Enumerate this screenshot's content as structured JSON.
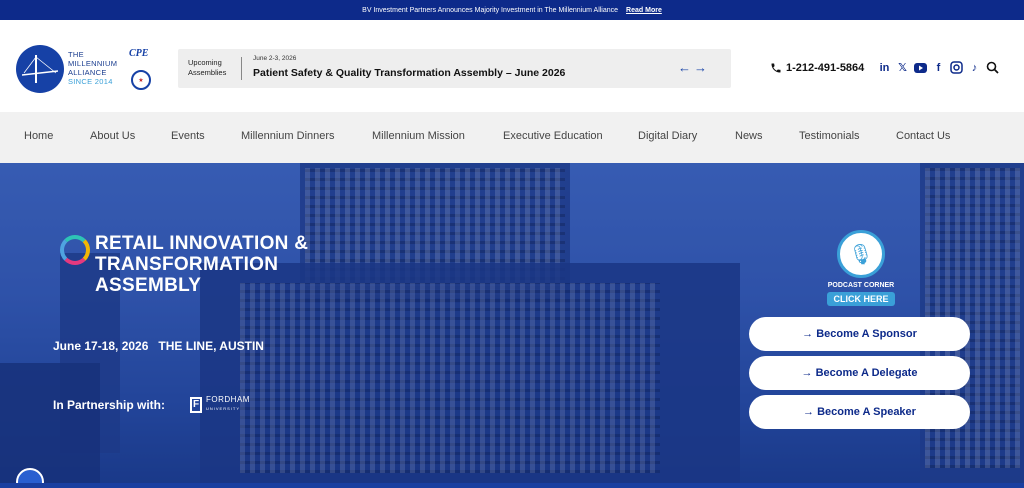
{
  "announcement": {
    "text": "BV Investment Partners Announces Majority Investment in The Millennium Alliance",
    "link": "Read More"
  },
  "brand": {
    "line1": "THE",
    "line2": "MILLENNIUM",
    "line3": "ALLIANCE",
    "since": "SINCE 2014",
    "cpe": "CPE"
  },
  "upcoming": {
    "label_line1": "Upcoming",
    "label_line2": "Assemblies",
    "date": "June 2-3, 2026",
    "title": "Patient Safety & Quality Transformation Assembly – June 2026",
    "arrows": "←→"
  },
  "contact": {
    "phone": "1-212-491-5864"
  },
  "socials": [
    "linkedin-icon",
    "x-icon",
    "youtube-icon",
    "facebook-icon",
    "instagram-icon",
    "tiktok-icon",
    "search-icon"
  ],
  "nav": [
    "Home",
    "About Us",
    "Events",
    "Millennium Dinners",
    "Millennium Mission",
    "Executive Education",
    "Digital Diary",
    "News",
    "Testimonials",
    "Contact Us"
  ],
  "hero": {
    "title_line1": "RETAIL INNOVATION &",
    "title_line2": "TRANSFORMATION",
    "title_line3": "ASSEMBLY",
    "date_location": "June 17-18, 2026   THE LINE, AUSTIN",
    "partner_label": "In Partnership with:",
    "partner_name": "FORDHAM",
    "partner_sub": "UNIVERSITY",
    "podcast_label": "PODCAST CORNER",
    "podcast_click": "CLICK HERE",
    "cta_sponsor": "→ Become A Sponsor",
    "cta_delegate": "→ Become A Delegate",
    "cta_speaker": "→ Become A Speaker"
  },
  "colors": {
    "brand_blue": "#0d2a8a",
    "accent": "#3aa0d8",
    "nav_bg": "#f1f1f1"
  }
}
